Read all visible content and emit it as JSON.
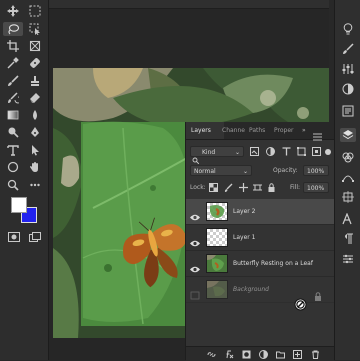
{
  "colors": {
    "foreground_swatch": "#ffffff",
    "background_swatch": "#2222ee",
    "ui_bg": "#282828",
    "panel_bg": "#333333",
    "selected_layer": "#494949"
  },
  "toolbar": {
    "tools": [
      {
        "name": "move-tool-icon"
      },
      {
        "name": "marquee-tool-icon"
      },
      {
        "name": "lasso-tool-icon",
        "selected": true
      },
      {
        "name": "object-selection-tool-icon"
      },
      {
        "name": "crop-tool-icon"
      },
      {
        "name": "frame-tool-icon"
      },
      {
        "name": "eyedropper-tool-icon"
      },
      {
        "name": "healing-brush-tool-icon"
      },
      {
        "name": "brush-tool-icon"
      },
      {
        "name": "clone-stamp-tool-icon"
      },
      {
        "name": "history-brush-tool-icon"
      },
      {
        "name": "eraser-tool-icon"
      },
      {
        "name": "gradient-tool-icon"
      },
      {
        "name": "blur-tool-icon"
      },
      {
        "name": "dodge-tool-icon"
      },
      {
        "name": "pen-tool-icon"
      },
      {
        "name": "type-tool-icon"
      },
      {
        "name": "path-selection-tool-icon"
      },
      {
        "name": "ellipse-tool-icon"
      },
      {
        "name": "hand-tool-icon"
      },
      {
        "name": "zoom-tool-icon"
      },
      {
        "name": "edit-toolbar-icon"
      }
    ]
  },
  "right_strip": {
    "icons": [
      "lightbulb-icon",
      "brush-settings-icon",
      "adjustments-icon",
      "circle-half-icon",
      "history-icon",
      "layers-icon",
      "channels-icon",
      "paths-icon",
      "character-icon",
      "paragraph-icon",
      "properties-icon"
    ]
  },
  "panel": {
    "tabs": [
      "Layers",
      "Channe",
      "Paths",
      "Proper"
    ],
    "active_tab": "Layers",
    "menu_icon": "panel-menu-icon",
    "filter": {
      "label": "Kind"
    },
    "blend_mode": "Normal",
    "opacity": {
      "label": "Opacity:",
      "value": "100%"
    },
    "lock": {
      "label": "Lock:"
    },
    "fill": {
      "label": "Fill:",
      "value": "100%"
    },
    "layers": [
      {
        "name": "Layer 2",
        "selected": true,
        "thumb": "checker"
      },
      {
        "name": "Layer 1",
        "selected": false,
        "thumb": "checker"
      },
      {
        "name": "Butterfly Resting on a Leaf",
        "selected": false,
        "thumb": "photo"
      },
      {
        "name": "Background",
        "selected": false,
        "thumb": "photo",
        "hidden_state": true
      }
    ]
  }
}
